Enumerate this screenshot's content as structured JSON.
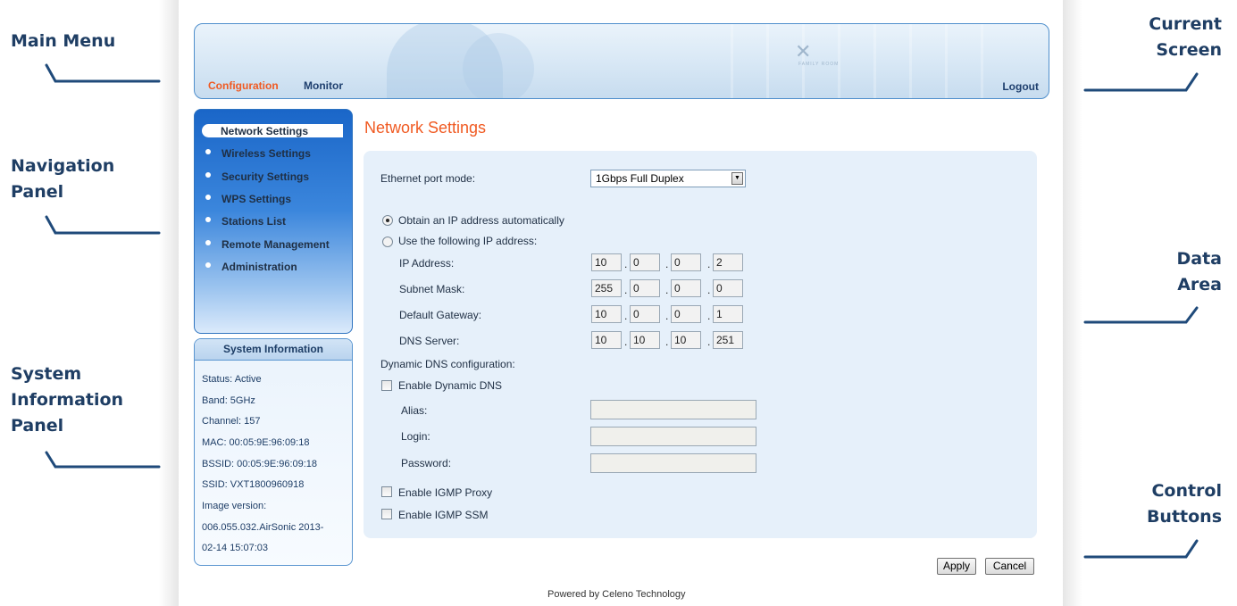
{
  "callouts": {
    "main_menu": "Main Menu",
    "navigation_panel": [
      "Navigation",
      "Panel"
    ],
    "system_information_panel": [
      "System",
      "Information",
      "Panel"
    ],
    "current_screen": [
      "Current",
      "Screen"
    ],
    "data_area": [
      "Data",
      "Area"
    ],
    "control_buttons": [
      "Control",
      "Buttons"
    ]
  },
  "header": {
    "menu": [
      "Configuration",
      "Monitor"
    ],
    "active_menu": "Configuration",
    "logout": "Logout",
    "brand_text": "FAMILY ROOM"
  },
  "nav": {
    "active": "Network Settings",
    "items": [
      "Wireless Settings",
      "Security Settings",
      "WPS Settings",
      "Stations List",
      "Remote Management",
      "Administration"
    ]
  },
  "system_info": {
    "title": "System Information",
    "rows": [
      "Status: Active",
      "Band: 5GHz",
      "Channel: 157",
      "MAC: 00:05:9E:96:09:18",
      "BSSID: 00:05:9E:96:09:18",
      "SSID: VXT1800960918",
      "Image version:",
      "006.055.032.AirSonic 2013-",
      "02-14 15:07:03"
    ]
  },
  "content": {
    "title": "Network Settings",
    "ethernet_label": "Ethernet port mode:",
    "ethernet_value": "1Gbps Full Duplex",
    "radio_auto": "Obtain an IP address automatically",
    "radio_manual": "Use the following IP address:",
    "selected_ip_mode": "auto",
    "ip_label": "IP Address:",
    "ip": [
      "10",
      "0",
      "0",
      "2"
    ],
    "subnet_label": "Subnet Mask:",
    "subnet": [
      "255",
      "0",
      "0",
      "0"
    ],
    "gateway_label": "Default Gateway:",
    "gateway": [
      "10",
      "0",
      "0",
      "1"
    ],
    "dns_label": "DNS Server:",
    "dns": [
      "10",
      "10",
      "10",
      "251"
    ],
    "ddns_title": "Dynamic DNS configuration:",
    "ddns_enable": "Enable Dynamic DNS",
    "ddns_enabled": false,
    "alias_label": "Alias:",
    "login_label": "Login:",
    "password_label": "Password:",
    "alias_value": "",
    "login_value": "",
    "password_value": "",
    "igmp_proxy": "Enable IGMP Proxy",
    "igmp_proxy_enabled": false,
    "igmp_ssm": "Enable IGMP SSM",
    "igmp_ssm_enabled": false
  },
  "buttons": {
    "apply": "Apply",
    "cancel": "Cancel"
  },
  "footer": "Powered by Celeno Technology",
  "colors": {
    "accent_orange": "#f05a22",
    "nav_blue": "#1a66c8",
    "callout_text": "#1f3e64",
    "data_area_bg": "#e6f0fa"
  }
}
